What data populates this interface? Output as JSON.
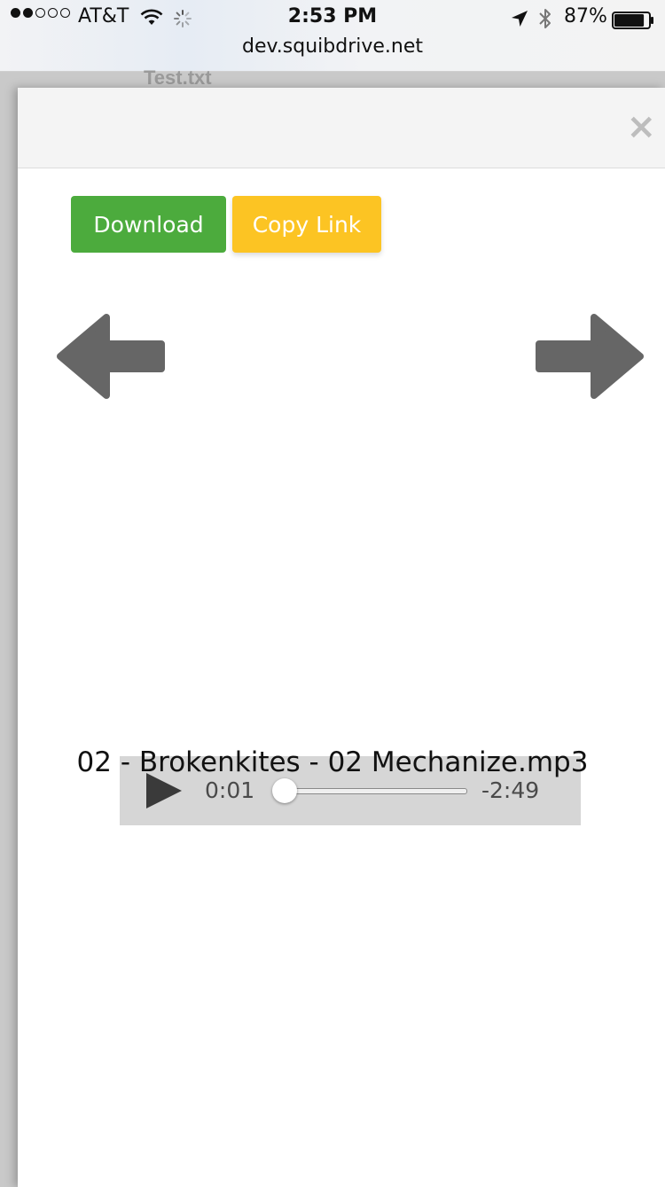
{
  "status_bar": {
    "signal_bars_filled": 2,
    "signal_bars_total": 5,
    "carrier": "AT&T",
    "time": "2:53 PM",
    "battery": "87%",
    "battery_level": 0.87,
    "icons": [
      "wifi-icon",
      "loading-spinner-icon",
      "location-arrow-icon",
      "bluetooth-icon",
      "battery-icon"
    ]
  },
  "browser": {
    "url": "dev.squibdrive.net"
  },
  "background_page": {
    "title": "Test.txt"
  },
  "modal": {
    "close_label": "×",
    "download_label": "Download",
    "copy_link_label": "Copy Link",
    "prev_icon": "arrow-left-icon",
    "next_icon": "arrow-right-icon"
  },
  "audio": {
    "current_time": "0:01",
    "remaining_time": "-2:49",
    "progress": 0.006,
    "file_name": "02 - Brokenkites - 02 Mechanize.mp3"
  },
  "colors": {
    "download_button": "#4cab3d",
    "copy_link_button": "#fcc423",
    "arrow": "#666666",
    "player_background": "#d6d6d6"
  }
}
